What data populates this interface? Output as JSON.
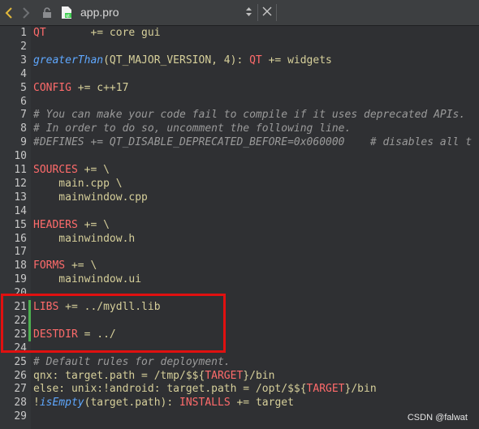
{
  "toolbar": {
    "back_icon": "chevron-left-icon",
    "forward_icon": "chevron-right-icon",
    "lock_icon": "lock-icon",
    "file_icon": "qt-project-file-icon",
    "file_name": "app.pro",
    "file_switch_icon": "up-down-arrows-icon",
    "close_label": "✕"
  },
  "lines": [
    {
      "n": "1",
      "code": [
        {
          "t": "QT",
          "c": "kw"
        },
        {
          "t": "       += core gui",
          "c": "pl"
        }
      ]
    },
    {
      "n": "2",
      "code": []
    },
    {
      "n": "3",
      "code": [
        {
          "t": "greaterThan",
          "c": "fn"
        },
        {
          "t": "(QT_MAJOR_VERSION, 4): ",
          "c": "pl"
        },
        {
          "t": "QT",
          "c": "kw"
        },
        {
          "t": " += widgets",
          "c": "pl"
        }
      ]
    },
    {
      "n": "4",
      "code": []
    },
    {
      "n": "5",
      "code": [
        {
          "t": "CONFIG",
          "c": "kw"
        },
        {
          "t": " += c++17",
          "c": "pl"
        }
      ]
    },
    {
      "n": "6",
      "code": []
    },
    {
      "n": "7",
      "code": [
        {
          "t": "# You can make your code fail to compile if it uses deprecated APIs.",
          "c": "cm"
        }
      ]
    },
    {
      "n": "8",
      "code": [
        {
          "t": "# In order to do so, uncomment the following line.",
          "c": "cm"
        }
      ]
    },
    {
      "n": "9",
      "code": [
        {
          "t": "#DEFINES += QT_DISABLE_DEPRECATED_BEFORE=0x060000    # disables all t",
          "c": "cm"
        }
      ]
    },
    {
      "n": "10",
      "code": []
    },
    {
      "n": "11",
      "code": [
        {
          "t": "SOURCES",
          "c": "kw"
        },
        {
          "t": " += \\",
          "c": "pl"
        }
      ]
    },
    {
      "n": "12",
      "code": [
        {
          "t": "    main.cpp \\",
          "c": "pl"
        }
      ]
    },
    {
      "n": "13",
      "code": [
        {
          "t": "    mainwindow.cpp",
          "c": "pl"
        }
      ]
    },
    {
      "n": "14",
      "code": []
    },
    {
      "n": "15",
      "code": [
        {
          "t": "HEADERS",
          "c": "kw"
        },
        {
          "t": " += \\",
          "c": "pl"
        }
      ]
    },
    {
      "n": "16",
      "code": [
        {
          "t": "    mainwindow.h",
          "c": "pl"
        }
      ]
    },
    {
      "n": "17",
      "code": []
    },
    {
      "n": "18",
      "code": [
        {
          "t": "FORMS",
          "c": "kw"
        },
        {
          "t": " += \\",
          "c": "pl"
        }
      ]
    },
    {
      "n": "19",
      "code": [
        {
          "t": "    mainwindow.ui",
          "c": "pl"
        }
      ]
    },
    {
      "n": "20",
      "code": []
    },
    {
      "n": "21",
      "code": [
        {
          "t": "LIBS",
          "c": "kw"
        },
        {
          "t": " += ../mydll.lib",
          "c": "pl"
        }
      ],
      "changed": true
    },
    {
      "n": "22",
      "code": [],
      "changed": true
    },
    {
      "n": "23",
      "code": [
        {
          "t": "DESTDIR",
          "c": "kw"
        },
        {
          "t": " = ../",
          "c": "pl"
        }
      ],
      "changed": true
    },
    {
      "n": "24",
      "code": []
    },
    {
      "n": "25",
      "code": [
        {
          "t": "# Default rules for deployment.",
          "c": "cm"
        }
      ]
    },
    {
      "n": "26",
      "code": [
        {
          "t": "qnx: target.path = /tmp/$${",
          "c": "pl"
        },
        {
          "t": "TARGET",
          "c": "kw"
        },
        {
          "t": "}/bin",
          "c": "pl"
        }
      ]
    },
    {
      "n": "27",
      "code": [
        {
          "t": "else: unix:!android: target.path = /opt/$${",
          "c": "pl"
        },
        {
          "t": "TARGET",
          "c": "kw"
        },
        {
          "t": "}/bin",
          "c": "pl"
        }
      ]
    },
    {
      "n": "28",
      "code": [
        {
          "t": "!",
          "c": "pl"
        },
        {
          "t": "isEmpty",
          "c": "fn"
        },
        {
          "t": "(target.path): ",
          "c": "pl"
        },
        {
          "t": "INSTALLS",
          "c": "kw"
        },
        {
          "t": " += target",
          "c": "pl"
        }
      ]
    },
    {
      "n": "29",
      "code": []
    }
  ],
  "watermark": "CSDN @falwat",
  "colors": {
    "background": "#2f3033",
    "keyword": "#ff6b6b",
    "function": "#5fa8ff",
    "comment": "#9a9a9a",
    "plain": "#d6cf9a",
    "change_marker": "#4caf50",
    "highlight_box": "#e01010"
  }
}
